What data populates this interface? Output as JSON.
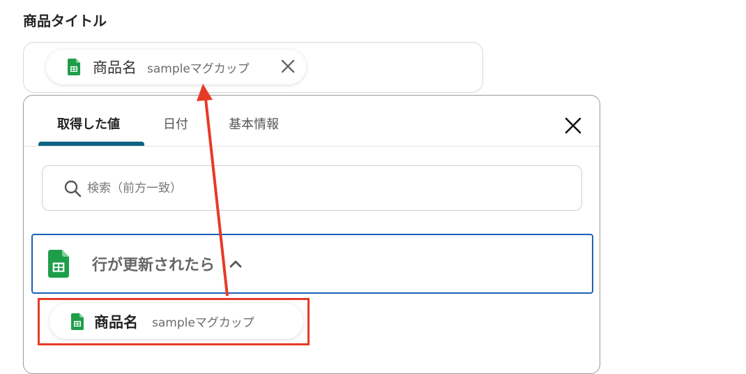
{
  "field": {
    "label": "商品タイトル",
    "value_chip": {
      "name": "商品名",
      "value": "sampleマグカップ",
      "icon": "google-sheets-icon",
      "close_icon": "close-icon"
    }
  },
  "panel": {
    "tabs": [
      {
        "label": "取得した値",
        "active": true
      },
      {
        "label": "日付",
        "active": false
      },
      {
        "label": "基本情報",
        "active": false
      }
    ],
    "close_icon": "close-icon",
    "search": {
      "placeholder": "検索（前方一致）",
      "value": "",
      "icon": "search-icon"
    },
    "group": {
      "title": "行が更新されたら",
      "icon": "google-sheets-icon",
      "expanded": true,
      "items": [
        {
          "name": "商品名",
          "value": "sampleマグカップ"
        }
      ]
    }
  },
  "colors": {
    "tab_indicator": "#0f6383",
    "group_border": "#1f60b5",
    "annotation": "#e73a25",
    "sheets_green": "#1e9e4a"
  }
}
